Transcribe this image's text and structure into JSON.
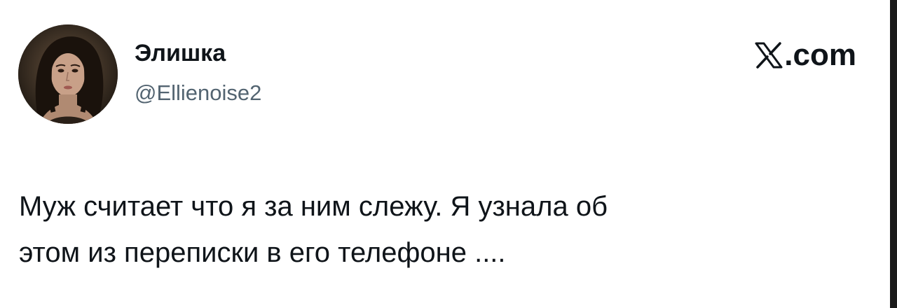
{
  "author": {
    "avatar_icon": "user-avatar-photo",
    "display_name": "Элишка",
    "handle": "@Ellienoise2"
  },
  "brand": {
    "logo_icon": "x-logo-icon",
    "suffix": ".com"
  },
  "tweet": {
    "lines": [
      "Муж считает что я за ним слежу. Я узнала об",
      "этом из переписки в его телефоне ...."
    ]
  }
}
